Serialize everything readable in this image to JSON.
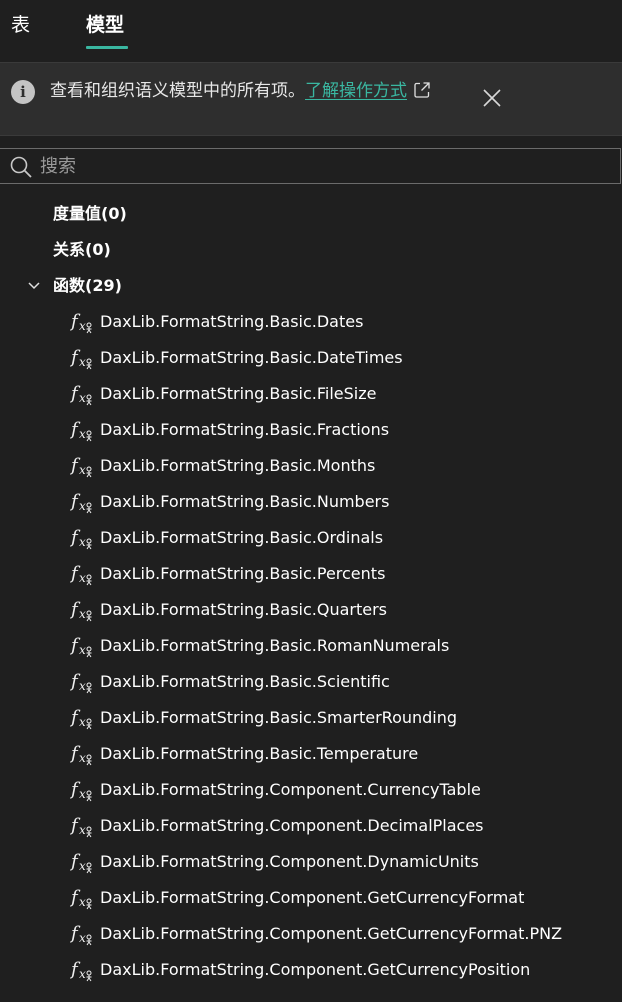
{
  "tabs": [
    {
      "label": "表",
      "active": false
    },
    {
      "label": "模型",
      "active": true
    }
  ],
  "accent_color": "#3ab7a1",
  "banner": {
    "text": "查看和组织语义模型中的所有项。",
    "link_text": "了解操作方式",
    "icon": "info-icon"
  },
  "search": {
    "placeholder": "搜索",
    "value": ""
  },
  "tree": {
    "measures": {
      "label": "度量值(0)"
    },
    "relationships": {
      "label": "关系(0)"
    },
    "functions": {
      "label": "函数(29)",
      "expanded": true,
      "items": [
        "DaxLib.FormatString.Basic.Dates",
        "DaxLib.FormatString.Basic.DateTimes",
        "DaxLib.FormatString.Basic.FileSize",
        "DaxLib.FormatString.Basic.Fractions",
        "DaxLib.FormatString.Basic.Months",
        "DaxLib.FormatString.Basic.Numbers",
        "DaxLib.FormatString.Basic.Ordinals",
        "DaxLib.FormatString.Basic.Percents",
        "DaxLib.FormatString.Basic.Quarters",
        "DaxLib.FormatString.Basic.RomanNumerals",
        "DaxLib.FormatString.Basic.Scientific",
        "DaxLib.FormatString.Basic.SmarterRounding",
        "DaxLib.FormatString.Basic.Temperature",
        "DaxLib.FormatString.Component.CurrencyTable",
        "DaxLib.FormatString.Component.DecimalPlaces",
        "DaxLib.FormatString.Component.DynamicUnits",
        "DaxLib.FormatString.Component.GetCurrencyFormat",
        "DaxLib.FormatString.Component.GetCurrencyFormat.PNZ",
        "DaxLib.FormatString.Component.GetCurrencyPosition"
      ]
    }
  }
}
